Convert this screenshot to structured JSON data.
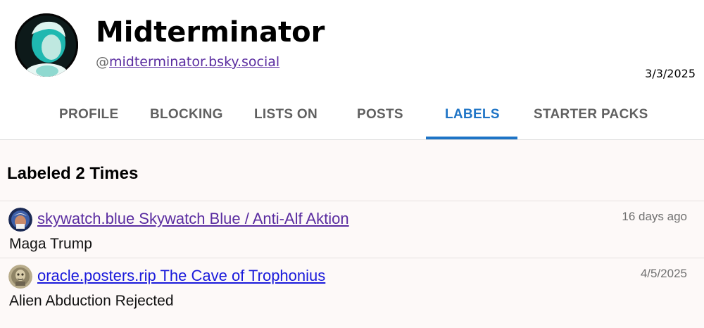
{
  "profile": {
    "display_name": "Midterminator",
    "handle_prefix": "@",
    "handle": "midterminator.bsky.social",
    "date": "3/3/2025",
    "avatar_icon": "portrait-avatar-icon"
  },
  "tabs": [
    {
      "label": "PROFILE",
      "active": false
    },
    {
      "label": "BLOCKING",
      "active": false
    },
    {
      "label": "LISTS ON",
      "active": false
    },
    {
      "label": "POSTS",
      "active": false
    },
    {
      "label": "LABELS",
      "active": true
    },
    {
      "label": "STARTER PACKS",
      "active": false
    }
  ],
  "colors": {
    "active_tab": "#1e74c6",
    "inactive_tab": "#606060",
    "visited_link": "#5a2ca0",
    "link": "#1a1adb",
    "content_bg": "#fdf9f8"
  },
  "labels_section": {
    "title": "Labeled 2 Times",
    "items": [
      {
        "labeler": "skywatch.blue Skywatch Blue / Anti-Alf Aktion",
        "time": "16 days ago",
        "label": "Maga Trump",
        "avatar_icon": "skywatch-avatar-icon"
      },
      {
        "labeler": "oracle.posters.rip The Cave of Trophonius",
        "time": "4/5/2025",
        "label": "Alien Abduction Rejected",
        "avatar_icon": "oracle-avatar-icon"
      }
    ]
  }
}
